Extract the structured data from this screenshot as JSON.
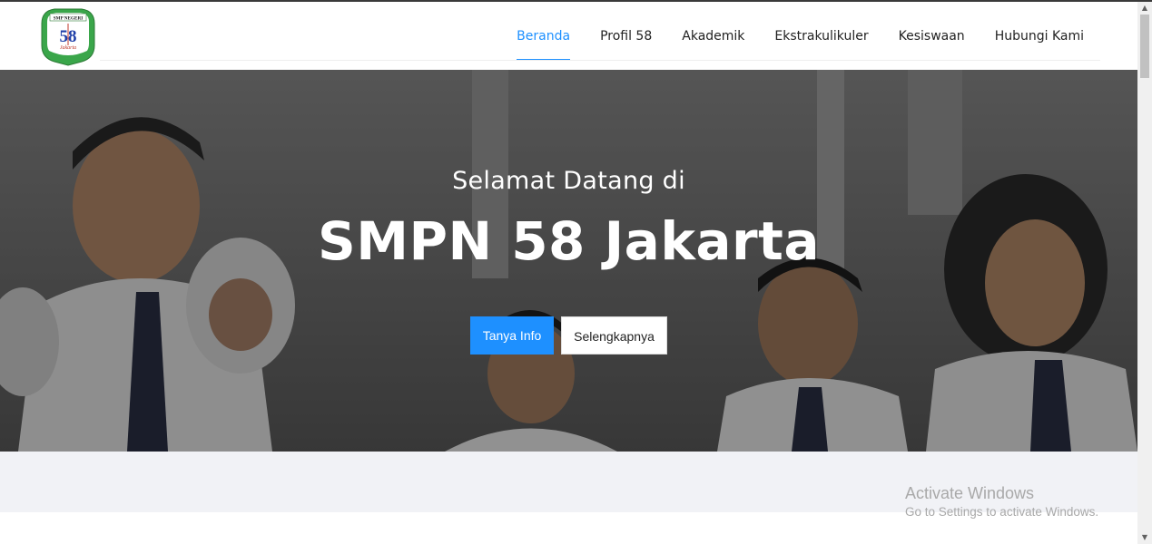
{
  "logo": {
    "top_text": "SMP NEGERI",
    "number": "58",
    "script_text": "Jakarta",
    "icon": "school-crest-logo"
  },
  "nav": {
    "items": [
      {
        "label": "Beranda",
        "active": true
      },
      {
        "label": "Profil 58",
        "active": false
      },
      {
        "label": "Akademik",
        "active": false
      },
      {
        "label": "Ekstrakulikuler",
        "active": false
      },
      {
        "label": "Kesiswaan",
        "active": false
      },
      {
        "label": "Hubungi Kami",
        "active": false
      }
    ]
  },
  "hero": {
    "subtitle": "Selamat Datang di",
    "title": "SMPN 58 Jakarta",
    "primary_button": "Tanya Info",
    "secondary_button": "Selengkapnya"
  },
  "watermark": {
    "title": "Activate Windows",
    "subtitle": "Go to Settings to activate Windows."
  },
  "colors": {
    "accent": "#1e90ff",
    "text": "#222222",
    "band": "#f1f2f6"
  }
}
